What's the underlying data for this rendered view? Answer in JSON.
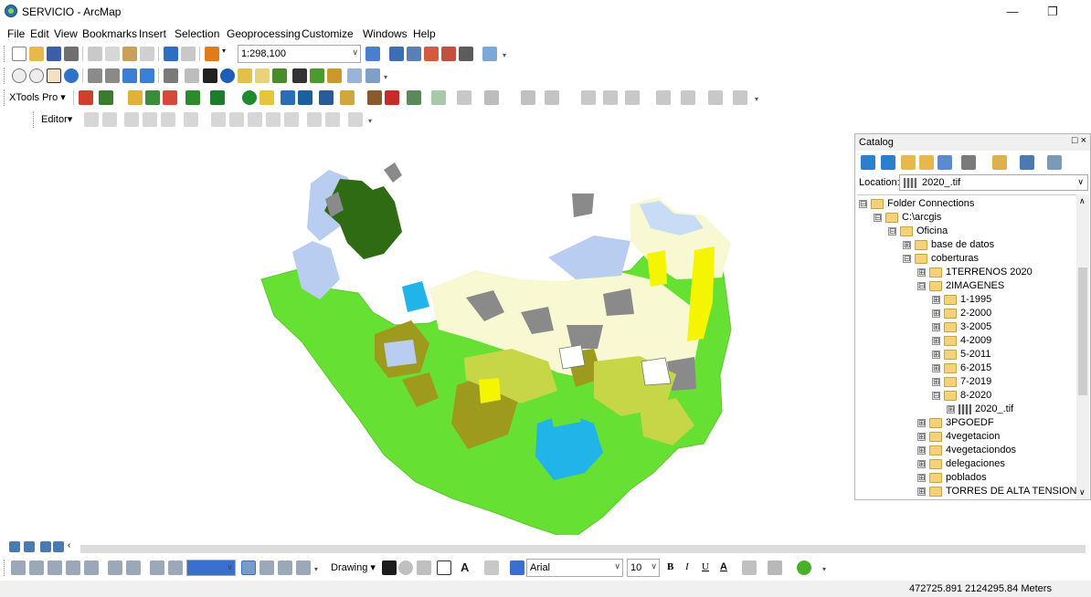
{
  "window": {
    "title": "SERVICIO - ArcMap",
    "minimize": "—",
    "restore": "❐"
  },
  "menu": [
    "File",
    "Edit",
    "View",
    "Bookmarks",
    "Insert",
    "Selection",
    "Geoprocessing",
    "Customize",
    "Windows",
    "Help"
  ],
  "toolbar": {
    "scale": "1:298,100",
    "xtools_label": "XTools Pro",
    "editor_label": "Editor"
  },
  "catalog": {
    "title": "Catalog",
    "close": "□ ×",
    "location_label": "Location:",
    "location_value": "2020_.tif",
    "tree": [
      {
        "label": "Folder Connections",
        "exp": "⊟"
      },
      {
        "label": "C:\\arcgis",
        "exp": "⊟"
      },
      {
        "label": "Oficina",
        "exp": "⊟"
      },
      {
        "label": "base de datos",
        "exp": "⊞"
      },
      {
        "label": "coberturas",
        "exp": "⊟"
      },
      {
        "label": "1TERRENOS 2020",
        "exp": "⊞"
      },
      {
        "label": "2IMAGENES",
        "exp": "⊟"
      },
      {
        "label": "1-1995",
        "exp": "⊞"
      },
      {
        "label": "2-2000",
        "exp": "⊞"
      },
      {
        "label": "3-2005",
        "exp": "⊞"
      },
      {
        "label": "4-2009",
        "exp": "⊞"
      },
      {
        "label": "5-2011",
        "exp": "⊞"
      },
      {
        "label": "6-2015",
        "exp": "⊞"
      },
      {
        "label": "7-2019",
        "exp": "⊞"
      },
      {
        "label": "8-2020",
        "exp": "⊟"
      },
      {
        "label": "2020_.tif",
        "exp": "⊞"
      },
      {
        "label": "3PGOEDF",
        "exp": "⊞"
      },
      {
        "label": "4vegetacion",
        "exp": "⊞"
      },
      {
        "label": "4vegetaciondos",
        "exp": "⊞"
      },
      {
        "label": "delegaciones",
        "exp": "⊞"
      },
      {
        "label": "poblados",
        "exp": "⊞"
      },
      {
        "label": "TORRES DE ALTA TENSION",
        "exp": "⊞"
      }
    ]
  },
  "drawing": {
    "label": "Drawing",
    "font": "Arial",
    "size": "10",
    "bold": "B",
    "italic": "I",
    "underline": "U",
    "font_color": "A"
  },
  "status": {
    "coordinates": "472725.891  2124295.84 Meters"
  },
  "colors": {
    "bright_green": "#66e032",
    "olive": "#9d9a1e",
    "dark_green": "#2e6b12",
    "light_yellow": "#f8f9d2",
    "yellow": "#f5f500",
    "gray": "#8a8a8a",
    "light_blue": "#b9cdf0",
    "cyan": "#20b4e8",
    "yellow_green": "#c6d646"
  }
}
